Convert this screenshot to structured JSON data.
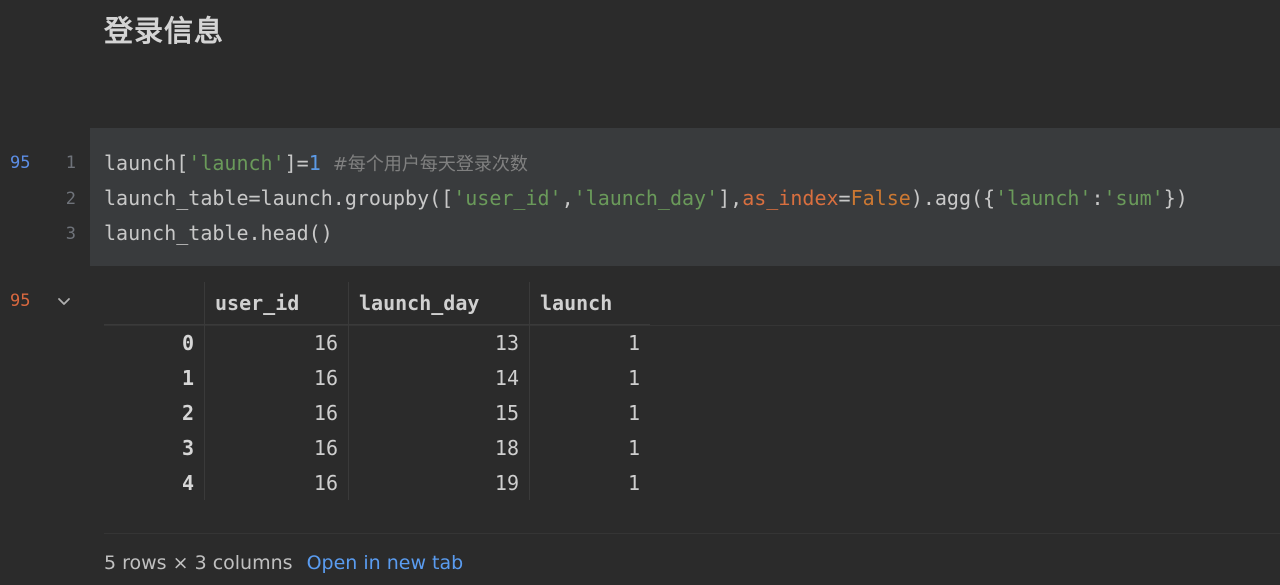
{
  "markdown": {
    "heading": "登录信息"
  },
  "code_cell": {
    "execution_count": "95",
    "lines": [
      {
        "number": "1"
      },
      {
        "number": "2"
      },
      {
        "number": "3"
      }
    ],
    "line1": {
      "a": "launch[",
      "b": "'launch'",
      "c": "]=",
      "d": "1",
      "e": " ",
      "comment": "#每个用户每天登录次数"
    },
    "line2": {
      "a": "launch_table=launch.groupby([",
      "b": "'user_id'",
      "c": ",",
      "d": "'launch_day'",
      "e": "],",
      "kwarg": "as_index",
      "f": "=",
      "kw": "False",
      "g": ").agg({",
      "h": "'launch'",
      "i": ":",
      "j": "'sum'",
      "k": "})"
    },
    "line3": {
      "a": "launch_table.head()"
    }
  },
  "output": {
    "execution_count": "95",
    "table": {
      "columns": [
        "user_id",
        "launch_day",
        "launch"
      ],
      "rows": [
        {
          "index": "0",
          "user_id": "16",
          "launch_day": "13",
          "launch": "1"
        },
        {
          "index": "1",
          "user_id": "16",
          "launch_day": "14",
          "launch": "1"
        },
        {
          "index": "2",
          "user_id": "16",
          "launch_day": "15",
          "launch": "1"
        },
        {
          "index": "3",
          "user_id": "16",
          "launch_day": "18",
          "launch": "1"
        },
        {
          "index": "4",
          "user_id": "16",
          "launch_day": "19",
          "launch": "1"
        }
      ]
    },
    "summary": "5 rows × 3 columns",
    "open_link": "Open in new tab"
  },
  "icons": {
    "collapse": "chevron-down-icon"
  },
  "colors": {
    "background": "#2b2b2b",
    "code_cell_bg": "#393b3d",
    "string": "#6a9a5a",
    "number": "#5c9ae6",
    "keyword": "#cc7832",
    "link": "#5a9cf0",
    "in_count": "#5c8ee6",
    "out_count": "#d9683f"
  }
}
